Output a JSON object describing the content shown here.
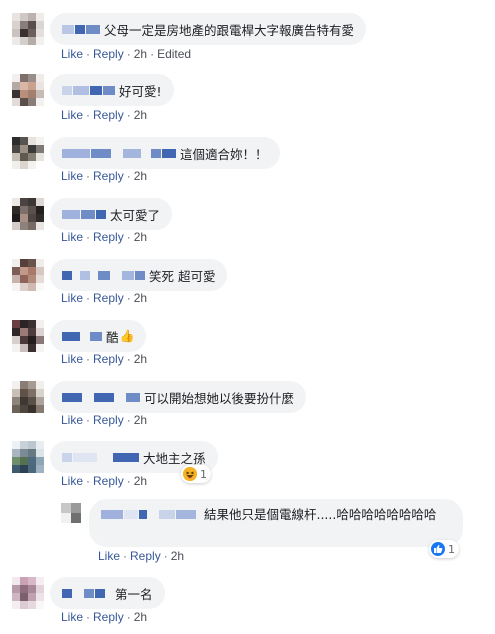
{
  "actions": {
    "like": "Like",
    "reply": "Reply",
    "sep": "·"
  },
  "colors": {
    "link": "#385898",
    "bubble": "#f2f3f5",
    "name_block": "#4267b2"
  },
  "comments": [
    {
      "text": "父母一定是房地產的跟電桿大字報廣告特有愛",
      "time": "2h",
      "edited": "Edited"
    },
    {
      "text": "好可愛!",
      "time": "2h"
    },
    {
      "text": "這個適合妳！！",
      "time": "2h"
    },
    {
      "text": "太可愛了",
      "time": "2h"
    },
    {
      "text": "笑死 超可愛",
      "time": "2h"
    },
    {
      "text": "酷",
      "emoji": "👍",
      "time": "2h"
    },
    {
      "text": "可以開始想她以後要扮什麼",
      "time": "2h"
    },
    {
      "text": "大地主之孫",
      "time": "2h",
      "reaction": {
        "icon": "haha-icon",
        "count": "1"
      }
    },
    {
      "text": "結果他只是個電線杆.....哈哈哈哈哈哈哈哈",
      "time": "2h",
      "reaction": {
        "icon": "like-icon",
        "count": "1"
      },
      "reply": true
    },
    {
      "text": "第一名",
      "time": "2h"
    }
  ]
}
